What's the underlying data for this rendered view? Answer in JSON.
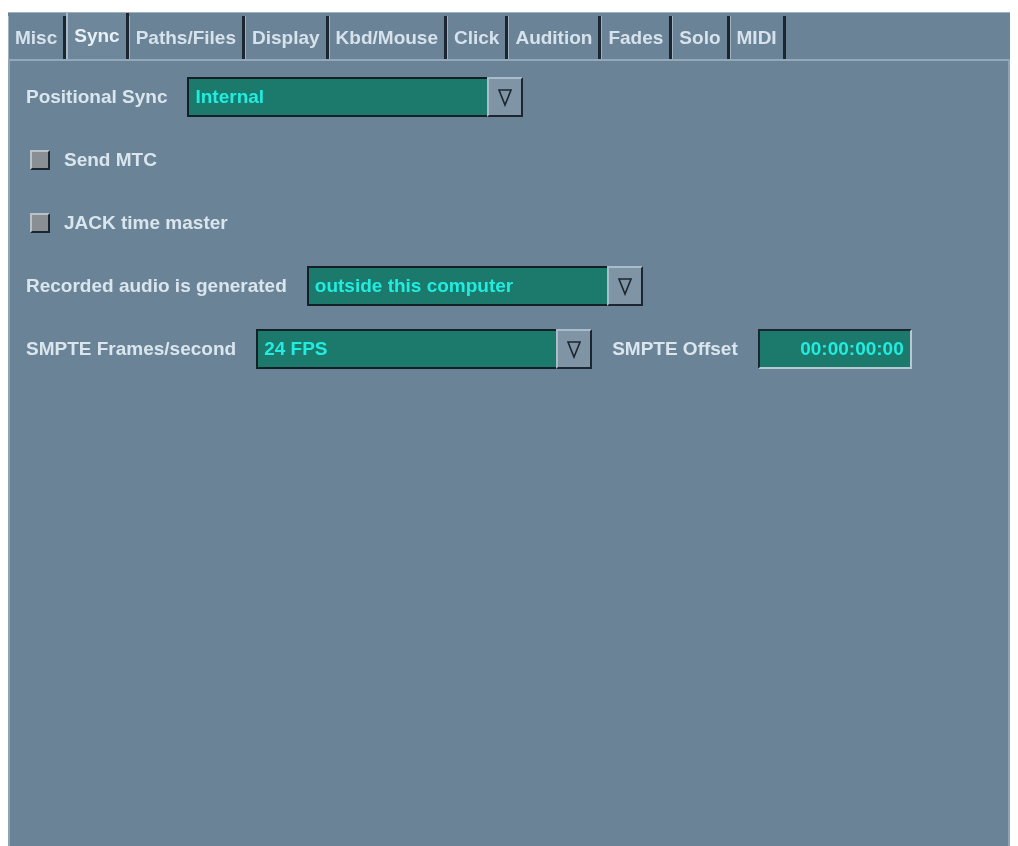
{
  "tabs": [
    {
      "label": "Misc",
      "selected": false
    },
    {
      "label": "Sync",
      "selected": true
    },
    {
      "label": "Paths/Files",
      "selected": false
    },
    {
      "label": "Display",
      "selected": false
    },
    {
      "label": "Kbd/Mouse",
      "selected": false
    },
    {
      "label": "Click",
      "selected": false
    },
    {
      "label": "Audition",
      "selected": false
    },
    {
      "label": "Fades",
      "selected": false
    },
    {
      "label": "Solo",
      "selected": false
    },
    {
      "label": "MIDI",
      "selected": false
    }
  ],
  "positional_sync": {
    "label": "Positional Sync",
    "value": "Internal"
  },
  "checkboxes": [
    {
      "label": "Send MTC",
      "checked": false
    },
    {
      "label": "JACK time master",
      "checked": false
    }
  ],
  "recorded_audio": {
    "label": "Recorded audio is generated",
    "value": "outside this computer"
  },
  "smpte_fps": {
    "label": "SMPTE Frames/second",
    "value": "24 FPS"
  },
  "smpte_offset": {
    "label": "SMPTE Offset",
    "value": "00:00:00:00"
  }
}
